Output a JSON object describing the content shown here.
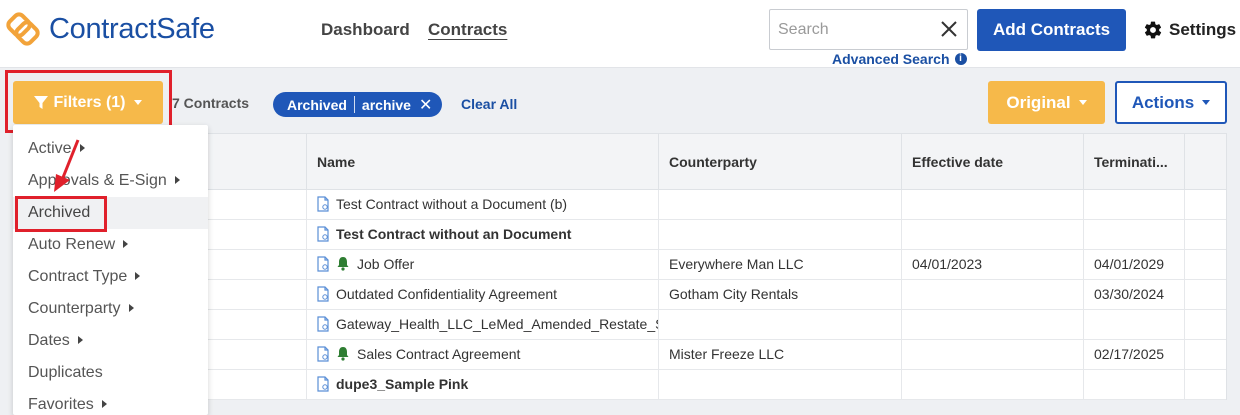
{
  "brand": {
    "name": "ContractSafe",
    "color": "#1a4fa3",
    "accent": "#f2a33a"
  },
  "nav": {
    "dashboard": "Dashboard",
    "contracts": "Contracts"
  },
  "search": {
    "placeholder": "Search",
    "value": "",
    "advanced_label": "Advanced Search",
    "info_icon": "info-icon"
  },
  "header": {
    "add_contracts": "Add Contracts",
    "settings": "Settings"
  },
  "toolbar": {
    "filters_label": "Filters (1)",
    "count_label": "7 Contracts",
    "chip": {
      "field": "Archived",
      "value": "archive"
    },
    "clear_all": "Clear All",
    "original_label": "Original",
    "actions_label": "Actions"
  },
  "filter_menu": {
    "items": [
      {
        "label": "Active",
        "submenu": true
      },
      {
        "label": "Approvals & E-Sign",
        "submenu": true
      },
      {
        "label": "Archived",
        "submenu": false,
        "selected": true
      },
      {
        "label": "Auto Renew",
        "submenu": true
      },
      {
        "label": "Contract Type",
        "submenu": true
      },
      {
        "label": "Counterparty",
        "submenu": true
      },
      {
        "label": "Dates",
        "submenu": true
      },
      {
        "label": "Duplicates",
        "submenu": false
      },
      {
        "label": "Favorites",
        "submenu": true
      }
    ]
  },
  "table": {
    "columns": [
      "Name",
      "Counterparty",
      "Effective date",
      "Terminati..."
    ],
    "rows": [
      {
        "name": "Test Contract without a Document (b)",
        "bold": false,
        "bell": false,
        "counterparty": "",
        "effective": "",
        "termination": ""
      },
      {
        "name": "Test Contract without an Document",
        "bold": true,
        "bell": false,
        "counterparty": "",
        "effective": "",
        "termination": ""
      },
      {
        "name": "Job Offer",
        "bold": false,
        "bell": true,
        "counterparty": "Everywhere Man LLC",
        "effective": "04/01/2023",
        "termination": "04/01/2029"
      },
      {
        "name": "Outdated Confidentiality Agreement",
        "bold": false,
        "bell": false,
        "counterparty": "Gotham City Rentals",
        "effective": "",
        "termination": "03/30/2024"
      },
      {
        "name": "Gateway_Health_LLC_LeMed_Amended_Restate_S",
        "bold": false,
        "bell": false,
        "counterparty": "",
        "effective": "",
        "termination": ""
      },
      {
        "name": "Sales Contract Agreement",
        "bold": false,
        "bell": true,
        "counterparty": "Mister Freeze LLC",
        "effective": "",
        "termination": "02/17/2025"
      },
      {
        "name": "dupe3_Sample Pink",
        "bold": true,
        "bell": false,
        "counterparty": "",
        "effective": "",
        "termination": ""
      }
    ]
  },
  "colors": {
    "primary_blue": "#1f57b8",
    "orange": "#f6b94a",
    "annotation_red": "#e0202b",
    "bell_green": "#2e7d32"
  }
}
